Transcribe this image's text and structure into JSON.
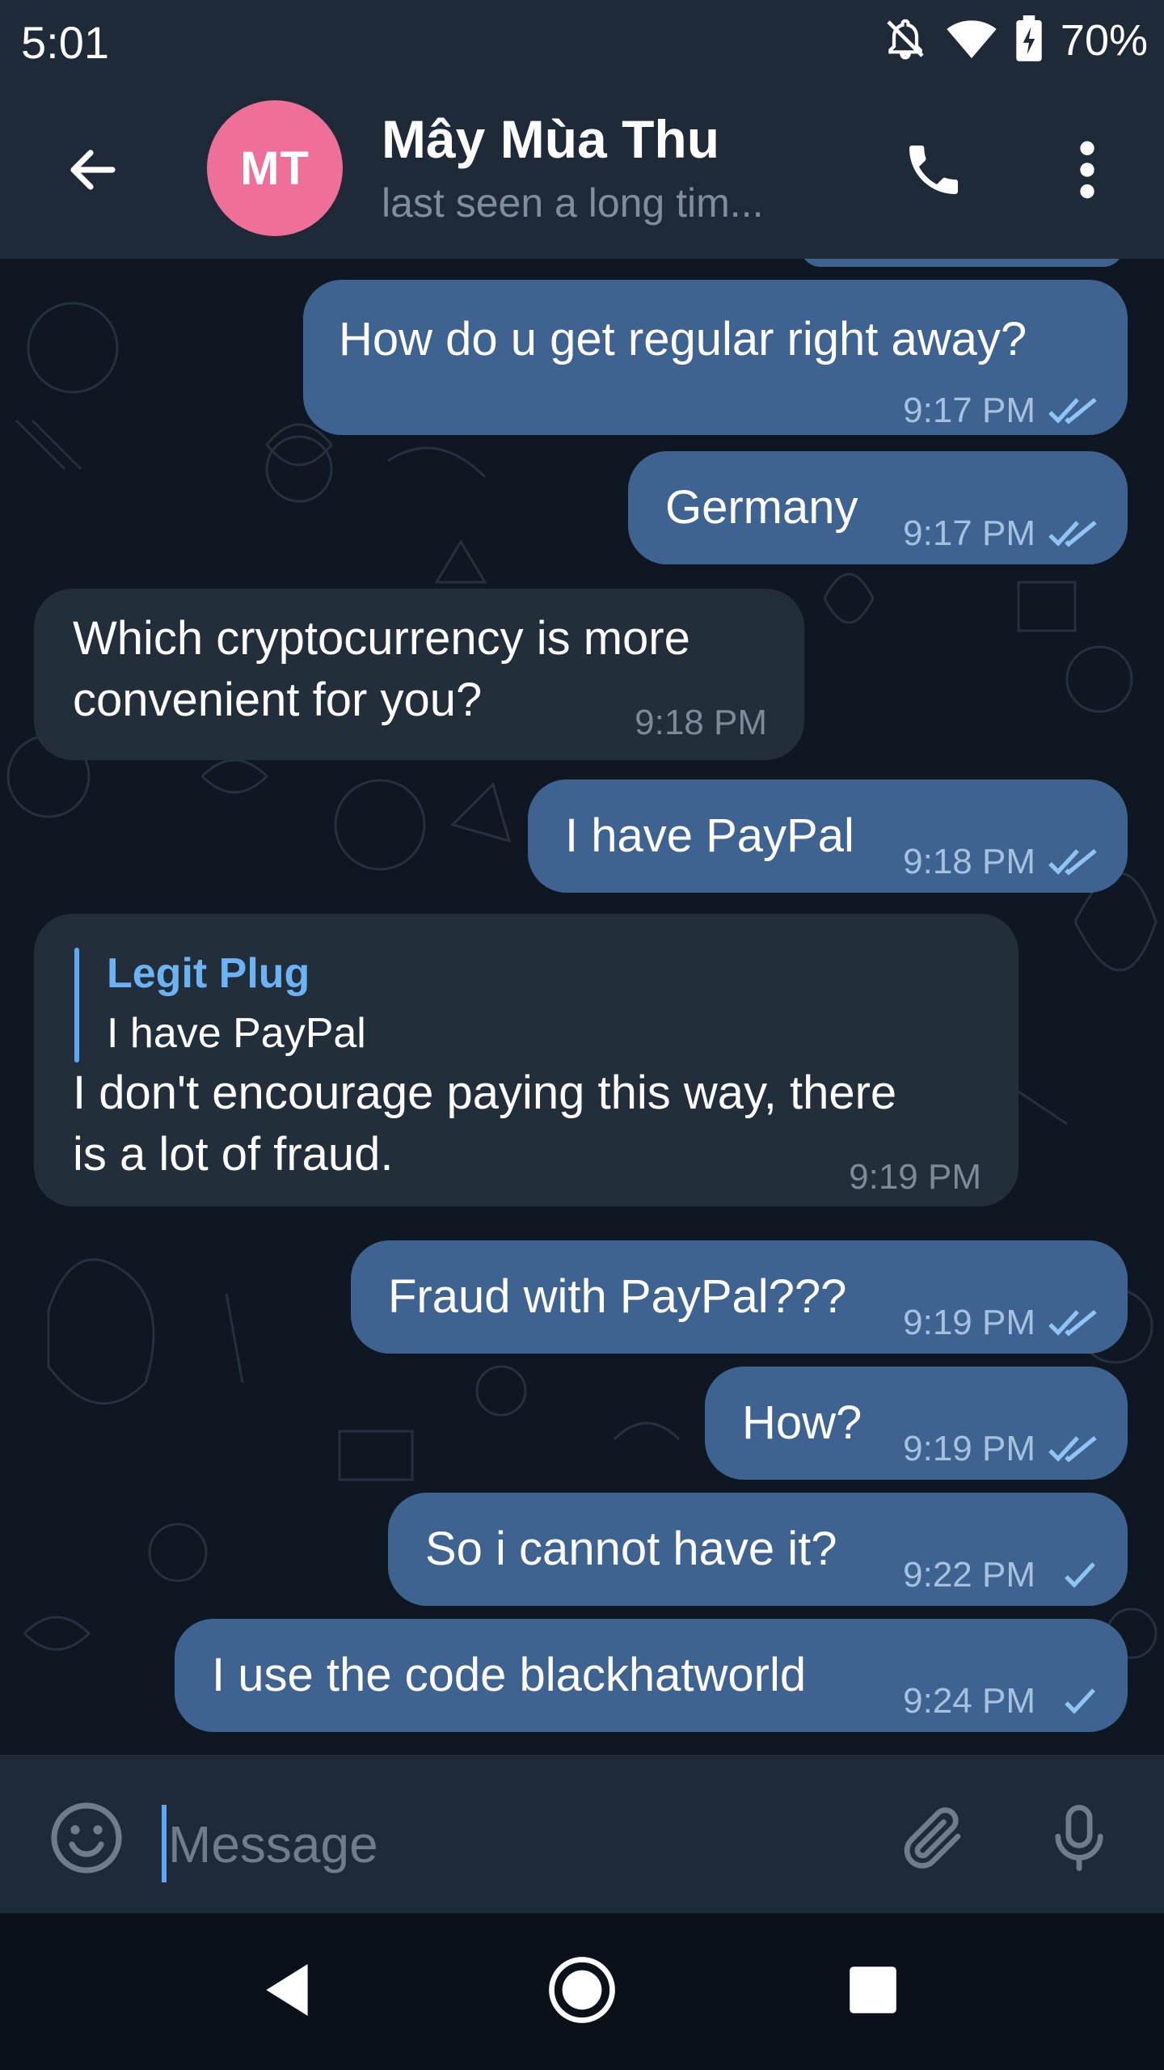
{
  "status_bar": {
    "time": "5:01",
    "battery_percent": "70%",
    "icons": [
      "notifications-off-icon",
      "wifi-icon",
      "battery-charging-icon"
    ]
  },
  "header": {
    "back_icon": "arrow-back-icon",
    "avatar_initials": "MT",
    "avatar_color": "#ee6f97",
    "contact_name": "Mây Mùa Thu",
    "contact_status": "last seen a long tim...",
    "call_icon": "phone-icon",
    "menu_icon": "more-vertical-icon"
  },
  "messages": [
    {
      "direction": "out",
      "text": "How do u get regular right away?",
      "time": "9:17 PM",
      "status": "read"
    },
    {
      "direction": "out",
      "text": "Germany",
      "time": "9:17 PM",
      "status": "read"
    },
    {
      "direction": "in",
      "text_lines": [
        "Which cryptocurrency is more",
        "convenient for you?"
      ],
      "time": "9:18 PM"
    },
    {
      "direction": "out",
      "text": "I have PayPal",
      "time": "9:18 PM",
      "status": "read"
    },
    {
      "direction": "in",
      "reply": {
        "name": "Legit Plug",
        "text": "I have PayPal"
      },
      "text_lines": [
        "I don't encourage paying this way, there",
        "is a lot of fraud."
      ],
      "time": "9:19 PM"
    },
    {
      "direction": "out",
      "text": "Fraud with PayPal???",
      "time": "9:19 PM",
      "status": "read"
    },
    {
      "direction": "out",
      "text": "How?",
      "time": "9:19 PM",
      "status": "read"
    },
    {
      "direction": "out",
      "text": "So i cannot have it?",
      "time": "9:22 PM",
      "status": "sent"
    },
    {
      "direction": "out",
      "text": "I use the code blackhatworld",
      "time": "9:24 PM",
      "status": "sent"
    }
  ],
  "input": {
    "placeholder": "Message",
    "emoji_icon": "emoji-icon",
    "attach_icon": "paperclip-icon",
    "mic_icon": "microphone-icon"
  },
  "nav": {
    "icons": [
      "nav-back-icon",
      "nav-home-icon",
      "nav-recents-icon"
    ]
  },
  "colors": {
    "outgoing_bubble": "#3f6390",
    "incoming_bubble": "#222e3a",
    "header_bg": "#1e2a37",
    "chat_bg": "#0f1722",
    "accent": "#5ea8f5"
  }
}
